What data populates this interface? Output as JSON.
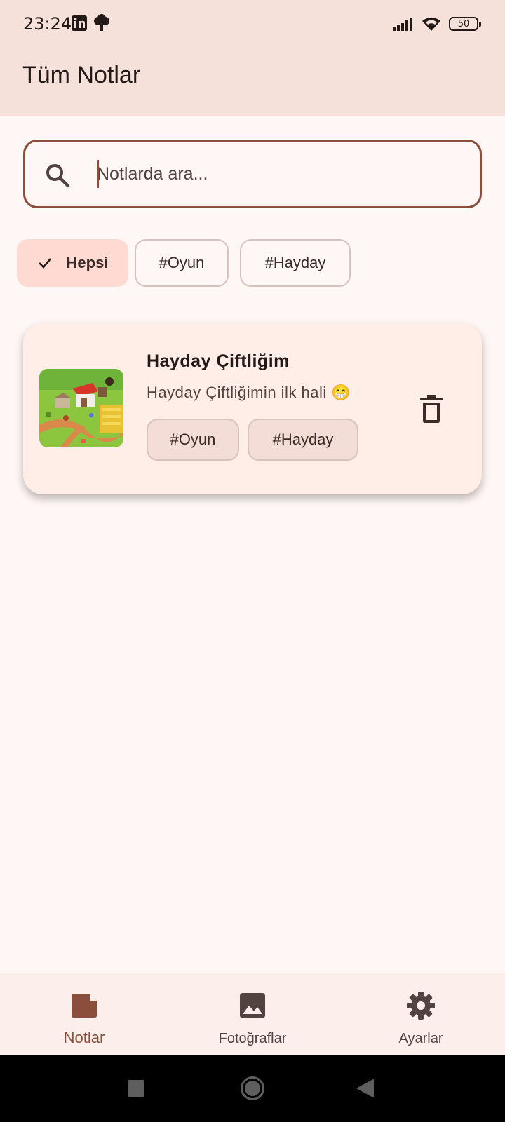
{
  "status_bar": {
    "time": "23:24",
    "left_icons": [
      "linkedin-icon",
      "tree-icon"
    ],
    "right_icons": [
      "signal-icon",
      "wifi-icon",
      "battery-icon"
    ],
    "battery": "50"
  },
  "app_bar": {
    "title": "Tüm Notlar"
  },
  "search": {
    "placeholder": "Notlarda ara...",
    "value": ""
  },
  "filters": [
    {
      "label": "Hepsi",
      "selected": true
    },
    {
      "label": "#Oyun",
      "selected": false
    },
    {
      "label": "#Hayday",
      "selected": false
    }
  ],
  "notes": [
    {
      "title": "Hayday Çiftliğim",
      "description": "Hayday Çiftliğimin ilk hali 😁",
      "tags": [
        "#Oyun",
        "#Hayday"
      ],
      "image_icon": "farm-thumbnail"
    }
  ],
  "bottom_nav": [
    {
      "label": "Notlar",
      "icon": "note-icon",
      "active": true
    },
    {
      "label": "Fotoğraflar",
      "icon": "photo-icon",
      "active": false
    },
    {
      "label": "Ayarlar",
      "icon": "settings-icon",
      "active": false
    }
  ],
  "system_nav": [
    "recent-apps-icon",
    "home-icon",
    "back-icon"
  ],
  "colors": {
    "background": "#FFF7F5",
    "app_bar": "#F5E0DA",
    "primary": "#8B4D3C",
    "selected_chip": "#FFDAD2",
    "card": "#FFEDE8"
  }
}
